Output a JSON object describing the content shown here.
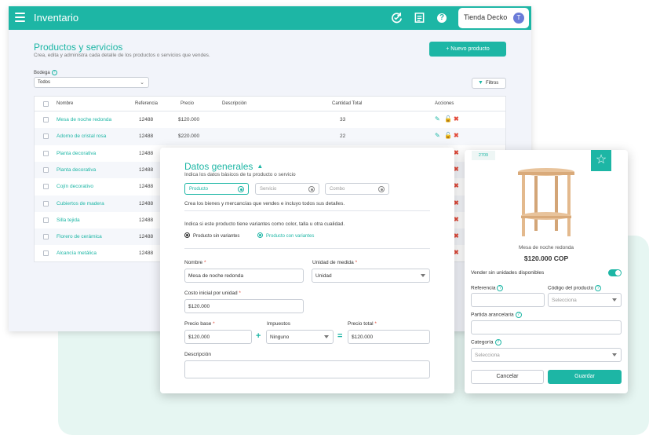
{
  "app": {
    "title": "Inventario",
    "user_name": "Tienda Decko",
    "avatar_initial": "T",
    "accent": "#1db6a5"
  },
  "header_icons": [
    "sync-icon",
    "receipt-icon",
    "help-icon"
  ],
  "page": {
    "title": "Productos y servicios",
    "subtitle": "Crea, edita y administra cada detalle de los productos o servicios que vendes.",
    "new_button": "+ Nuevo producto",
    "bodega_label": "Bodega",
    "bodega_value": "Todos",
    "filters_label": "Filtros"
  },
  "table": {
    "headers": [
      "Nombre",
      "Referencia",
      "Precio",
      "Descripción",
      "Cantidad Total",
      "Acciones"
    ],
    "rows": [
      {
        "name": "Mesa de noche redonda",
        "ref": "12488",
        "price": "$120.000",
        "qty": "33"
      },
      {
        "name": "Adorno de cristal rosa",
        "ref": "12488",
        "price": "$220.000",
        "qty": "22"
      },
      {
        "name": "Planta decorativa",
        "ref": "12488",
        "price": "",
        "qty": ""
      },
      {
        "name": "Planta decorativa",
        "ref": "12488",
        "price": "",
        "qty": ""
      },
      {
        "name": "Cojín decorativo",
        "ref": "12488",
        "price": "",
        "qty": ""
      },
      {
        "name": "Cubiertos de madera",
        "ref": "12488",
        "price": "",
        "qty": ""
      },
      {
        "name": "Silla tejida",
        "ref": "12488",
        "price": "",
        "qty": ""
      },
      {
        "name": "Florero de cerámica",
        "ref": "12488",
        "price": "",
        "qty": ""
      },
      {
        "name": "Alcancía metálica",
        "ref": "12488",
        "price": "",
        "qty": ""
      }
    ]
  },
  "modal": {
    "title": "Datos generales",
    "subtitle": "Indica los datos básicos de tu producto o servicio",
    "types": [
      "Producto",
      "Servicio",
      "Combo"
    ],
    "type_description": "Crea los bienes y mercancías que vendes e incluyo todos sus detalles.",
    "variants_question": "Indica si este producto tiene variantes como color, talla u otra cualidad.",
    "variant_options": [
      "Producto sin variantes",
      "Producto con variantes"
    ],
    "fields": {
      "nombre_label": "Nombre",
      "nombre_value": "Mesa de noche redonda",
      "unidad_label": "Unidad de medida",
      "unidad_value": "Unidad",
      "costo_label": "Costo inicial por unidad",
      "costo_value": "$120.000",
      "precio_base_label": "Precio base",
      "precio_base_value": "$120.000",
      "impuestos_label": "Impuestos",
      "impuestos_value": "Ninguno",
      "precio_total_label": "Precio total",
      "precio_total_value": "$120.000",
      "descripcion_label": "Descripción",
      "descripcion_value": ""
    },
    "required_mark": "*",
    "plus": "+",
    "equals": "="
  },
  "side": {
    "ref_tag": "2709",
    "product_name": "Mesa de noche redonda",
    "product_price": "$120.000 COP",
    "toggle_label": "Vender sin unidades disponibles",
    "referencia_label": "Referencia",
    "codigo_label": "Código del producto",
    "codigo_placeholder": "Selecciona",
    "partida_label": "Partida arancelaria",
    "categoria_label": "Categoría",
    "categoria_placeholder": "Selecciona",
    "cancel": "Cancelar",
    "save": "Guardar"
  }
}
